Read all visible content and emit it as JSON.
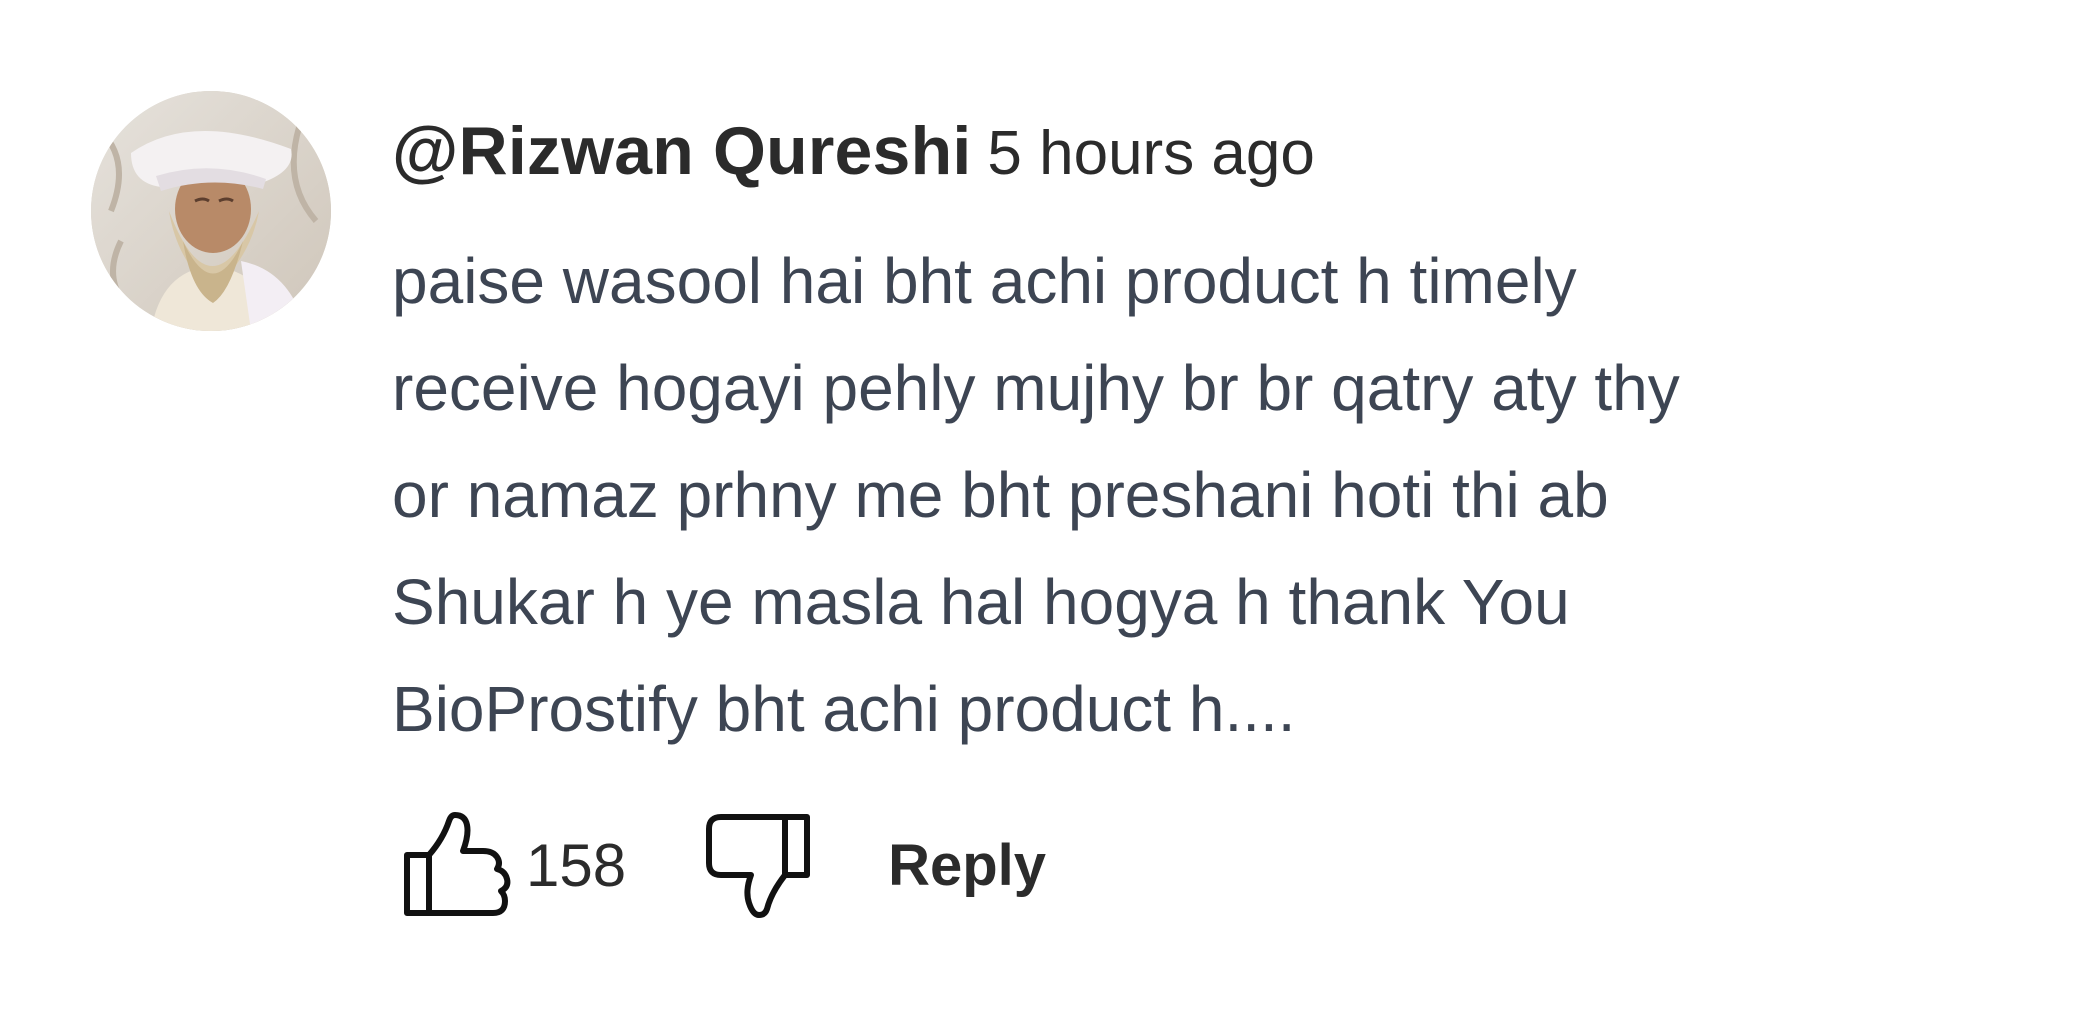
{
  "comment": {
    "author": "@Rizwan Qureshi",
    "time_ago": "5 hours ago",
    "text_lines": [
      "paise wasool hai bht achi product h timely",
      "receive hogayi pehly mujhy br br qatry aty thy",
      "or namaz prhny me bht preshani hoti thi ab",
      "Shukar h ye masla hal hogya h thank You",
      "BioProstify bht achi product h...."
    ],
    "like_count": "158",
    "reply_label": "Reply",
    "icons": {
      "like": "thumbs-up-icon",
      "dislike": "thumbs-down-icon"
    },
    "colors": {
      "author": "#2b2b2b",
      "body": "#3d4553",
      "background": "#ffffff"
    }
  }
}
